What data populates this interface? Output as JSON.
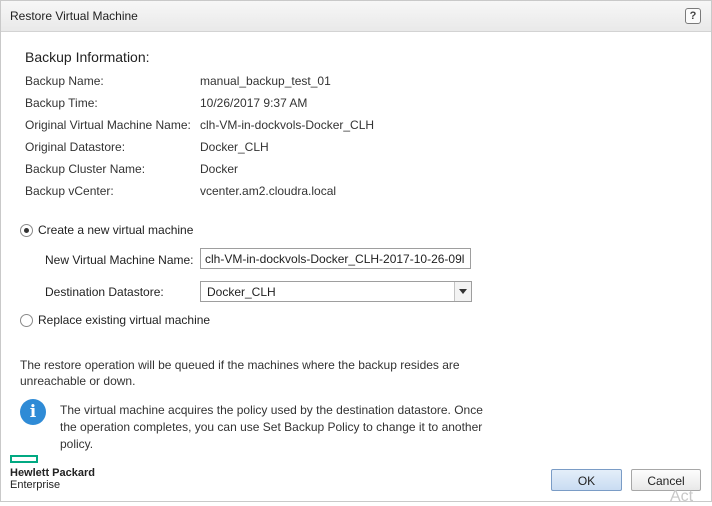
{
  "dialog": {
    "title": "Restore Virtual Machine",
    "help_glyph": "?"
  },
  "backup_info": {
    "heading": "Backup Information:",
    "rows": [
      {
        "label": "Backup Name:",
        "value": "manual_backup_test_01"
      },
      {
        "label": "Backup Time:",
        "value": "10/26/2017 9:37 AM"
      },
      {
        "label": "Original Virtual Machine Name:",
        "value": "clh-VM-in-dockvols-Docker_CLH"
      },
      {
        "label": "Original Datastore:",
        "value": "Docker_CLH"
      },
      {
        "label": "Backup Cluster Name:",
        "value": "Docker"
      },
      {
        "label": "Backup vCenter:",
        "value": "vcenter.am2.cloudra.local"
      }
    ]
  },
  "options": {
    "create_new": {
      "label": "Create a new virtual machine",
      "selected": true
    },
    "new_vm_name": {
      "label": "New Virtual Machine Name:",
      "value": "clh-VM-in-dockvols-Docker_CLH-2017-10-26-09l"
    },
    "destination": {
      "label": "Destination Datastore:",
      "selected": "Docker_CLH"
    },
    "replace_existing": {
      "label": "Replace existing virtual machine",
      "selected": false
    }
  },
  "note": "The restore operation will be queued if the machines where the backup resides are unreachable or down.",
  "info": {
    "icon": "info-icon",
    "text": "The virtual machine acquires the policy used by the destination datastore. Once the operation completes, you can use Set Backup Policy to change it to another policy."
  },
  "brand": {
    "line1": "Hewlett Packard",
    "line2": "Enterprise",
    "color": "#01a982"
  },
  "buttons": {
    "ok": "OK",
    "cancel": "Cancel"
  },
  "watermark": "Act"
}
